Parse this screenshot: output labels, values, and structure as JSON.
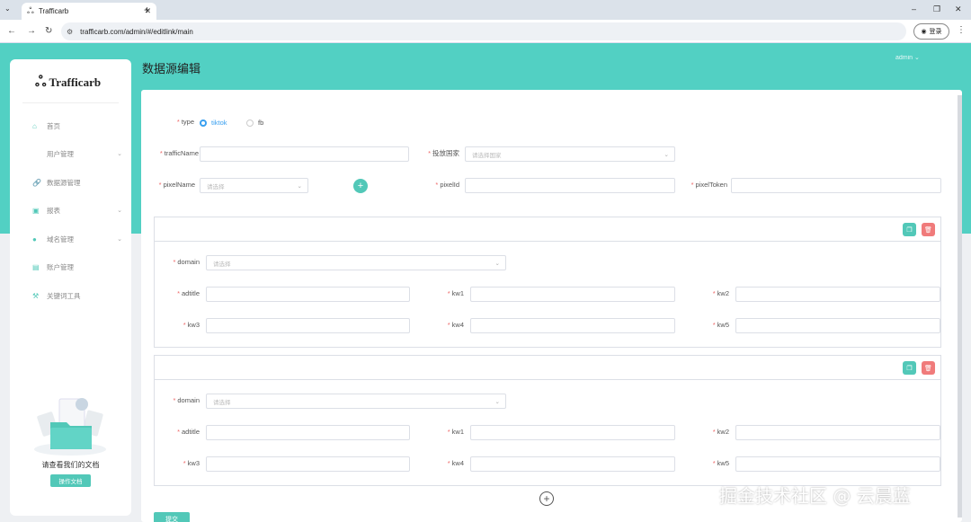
{
  "browser": {
    "tab_title": "Trafficarb",
    "url": "trafficarb.com/admin/#/editlink/main",
    "login_label": "登录",
    "window_controls": [
      "–",
      "❐",
      "✕"
    ]
  },
  "sidebar": {
    "logo": "Trafficarb",
    "items": [
      {
        "label": "首页",
        "icon": "home-icon"
      },
      {
        "label": "用户管理",
        "icon": ""
      },
      {
        "label": "数据源管理",
        "icon": "link-icon"
      },
      {
        "label": "报表",
        "icon": "report-icon"
      },
      {
        "label": "域名管理",
        "icon": "user-icon"
      },
      {
        "label": "账户管理",
        "icon": "card-icon"
      },
      {
        "label": "关键词工具",
        "icon": "tool-icon"
      }
    ],
    "doc_text": "请查看我们的文档",
    "doc_button": "操作文档"
  },
  "header": {
    "page_title": "数据源编辑",
    "user": "admin"
  },
  "form": {
    "type_label": "type",
    "type_options": [
      "tiktok",
      "fb"
    ],
    "type_selected": "tiktok",
    "trafficName_label": "trafficName",
    "country_label": "投放国家",
    "country_placeholder": "请选择国家",
    "pixelName_label": "pixelName",
    "pixelName_placeholder": "请选择",
    "pixelId_label": "pixelId",
    "pixelToken_label": "pixelToken",
    "groups": [
      {
        "domain_label": "domain",
        "domain_placeholder": "请选择",
        "adtitle_label": "adtitle",
        "kw1": "kw1",
        "kw2": "kw2",
        "kw3": "kw3",
        "kw4": "kw4",
        "kw5": "kw5"
      },
      {
        "domain_label": "domain",
        "domain_placeholder": "请选择",
        "adtitle_label": "adtitle",
        "kw1": "kw1",
        "kw2": "kw2",
        "kw3": "kw3",
        "kw4": "kw4",
        "kw5": "kw5"
      }
    ],
    "submit_label": "提交"
  },
  "watermark": "掘金技术社区 @ 云晨蓝"
}
